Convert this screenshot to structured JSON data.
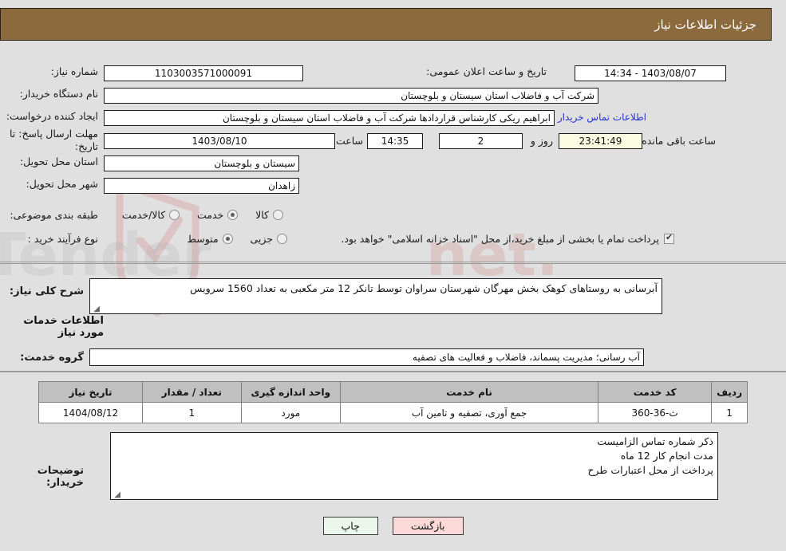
{
  "header": {
    "title": "جزئیات اطلاعات نیاز"
  },
  "watermark": {
    "text": "AriaTender.net"
  },
  "form": {
    "need_number_label": "شماره نیاز:",
    "need_number_value": "1103003571000091",
    "announce_label": "تاریخ و ساعت اعلان عمومی:",
    "announce_value": "1403/08/07 - 14:34",
    "buyer_org_label": "نام دستگاه خریدار:",
    "buyer_org_value": "شرکت آب و فاضلاب استان سیستان و بلوچستان",
    "creator_label": "ایجاد کننده درخواست:",
    "creator_value": "ابراهیم ریکی کارشناس قراردادها شرکت آب و فاضلاب استان سیستان و بلوچستان",
    "contact_link": "اطلاعات تماس خریدار",
    "deadline_label": "مهلت ارسال پاسخ: تا تاریخ:",
    "deadline_date": "1403/08/10",
    "hour_label": "ساعت",
    "deadline_time": "14:35",
    "days_value": "2",
    "days_label": "روز و",
    "countdown_value": "23:41:49",
    "remaining_label": "ساعت باقی مانده",
    "province_label": "استان محل تحویل:",
    "province_value": "سیستان و بلوچستان",
    "city_label": "شهر محل تحویل:",
    "city_value": "زاهدان",
    "category_label": "طبقه بندی موضوعی:",
    "category_options": [
      {
        "label": "کالا",
        "selected": false
      },
      {
        "label": "خدمت",
        "selected": true
      },
      {
        "label": "کالا/خدمت",
        "selected": false
      }
    ],
    "process_label": "نوع فرآیند خرید :",
    "process_options": [
      {
        "label": "جزیی",
        "selected": false
      },
      {
        "label": "متوسط",
        "selected": true
      }
    ],
    "treasury_checked": true,
    "treasury_text": "پرداخت تمام یا بخشی از مبلغ خرید،از محل \"اسناد خزانه اسلامی\" خواهد بود."
  },
  "description": {
    "label": "شرح کلی نیاز:",
    "value": "آبرسانی به روستاهای کوهک بخش مهرگان شهرستان سراوان توسط تانکر 12 متر مکعبی به تعداد 1560 سرویس"
  },
  "services": {
    "section_title": "اطلاعات خدمات مورد نیاز",
    "group_label": "گروه خدمت:",
    "group_value": "آب رسانی؛ مدیریت پسماند، فاضلاب و فعالیت های تصفیه",
    "columns": [
      "ردیف",
      "کد خدمت",
      "نام خدمت",
      "واحد اندازه گیری",
      "تعداد / مقدار",
      "تاریخ نیاز"
    ],
    "rows": [
      {
        "index": "1",
        "code": "ث-36-360",
        "name": "جمع آوری، تصفیه و تامین آب",
        "unit": "مورد",
        "quantity": "1",
        "date": "1404/08/12"
      }
    ]
  },
  "notes": {
    "label": "توضیحات خریدار:",
    "line1": "ذکر شماره تماس الزامیست",
    "line2": "مدت انجام کار  12 ماه",
    "line3": "پرداخت از محل اعتبارات طرح"
  },
  "buttons": {
    "print": "چاپ",
    "back": "بازگشت"
  },
  "colors": {
    "header_bar": "#8b6b3e",
    "page_bg": "#e0e0e0",
    "link": "#2233cc",
    "table_header": "#c0c0c0",
    "countdown_bg": "#fbfbe2",
    "print_btn": "#eaf7ea",
    "back_btn": "#fbd9d9"
  }
}
